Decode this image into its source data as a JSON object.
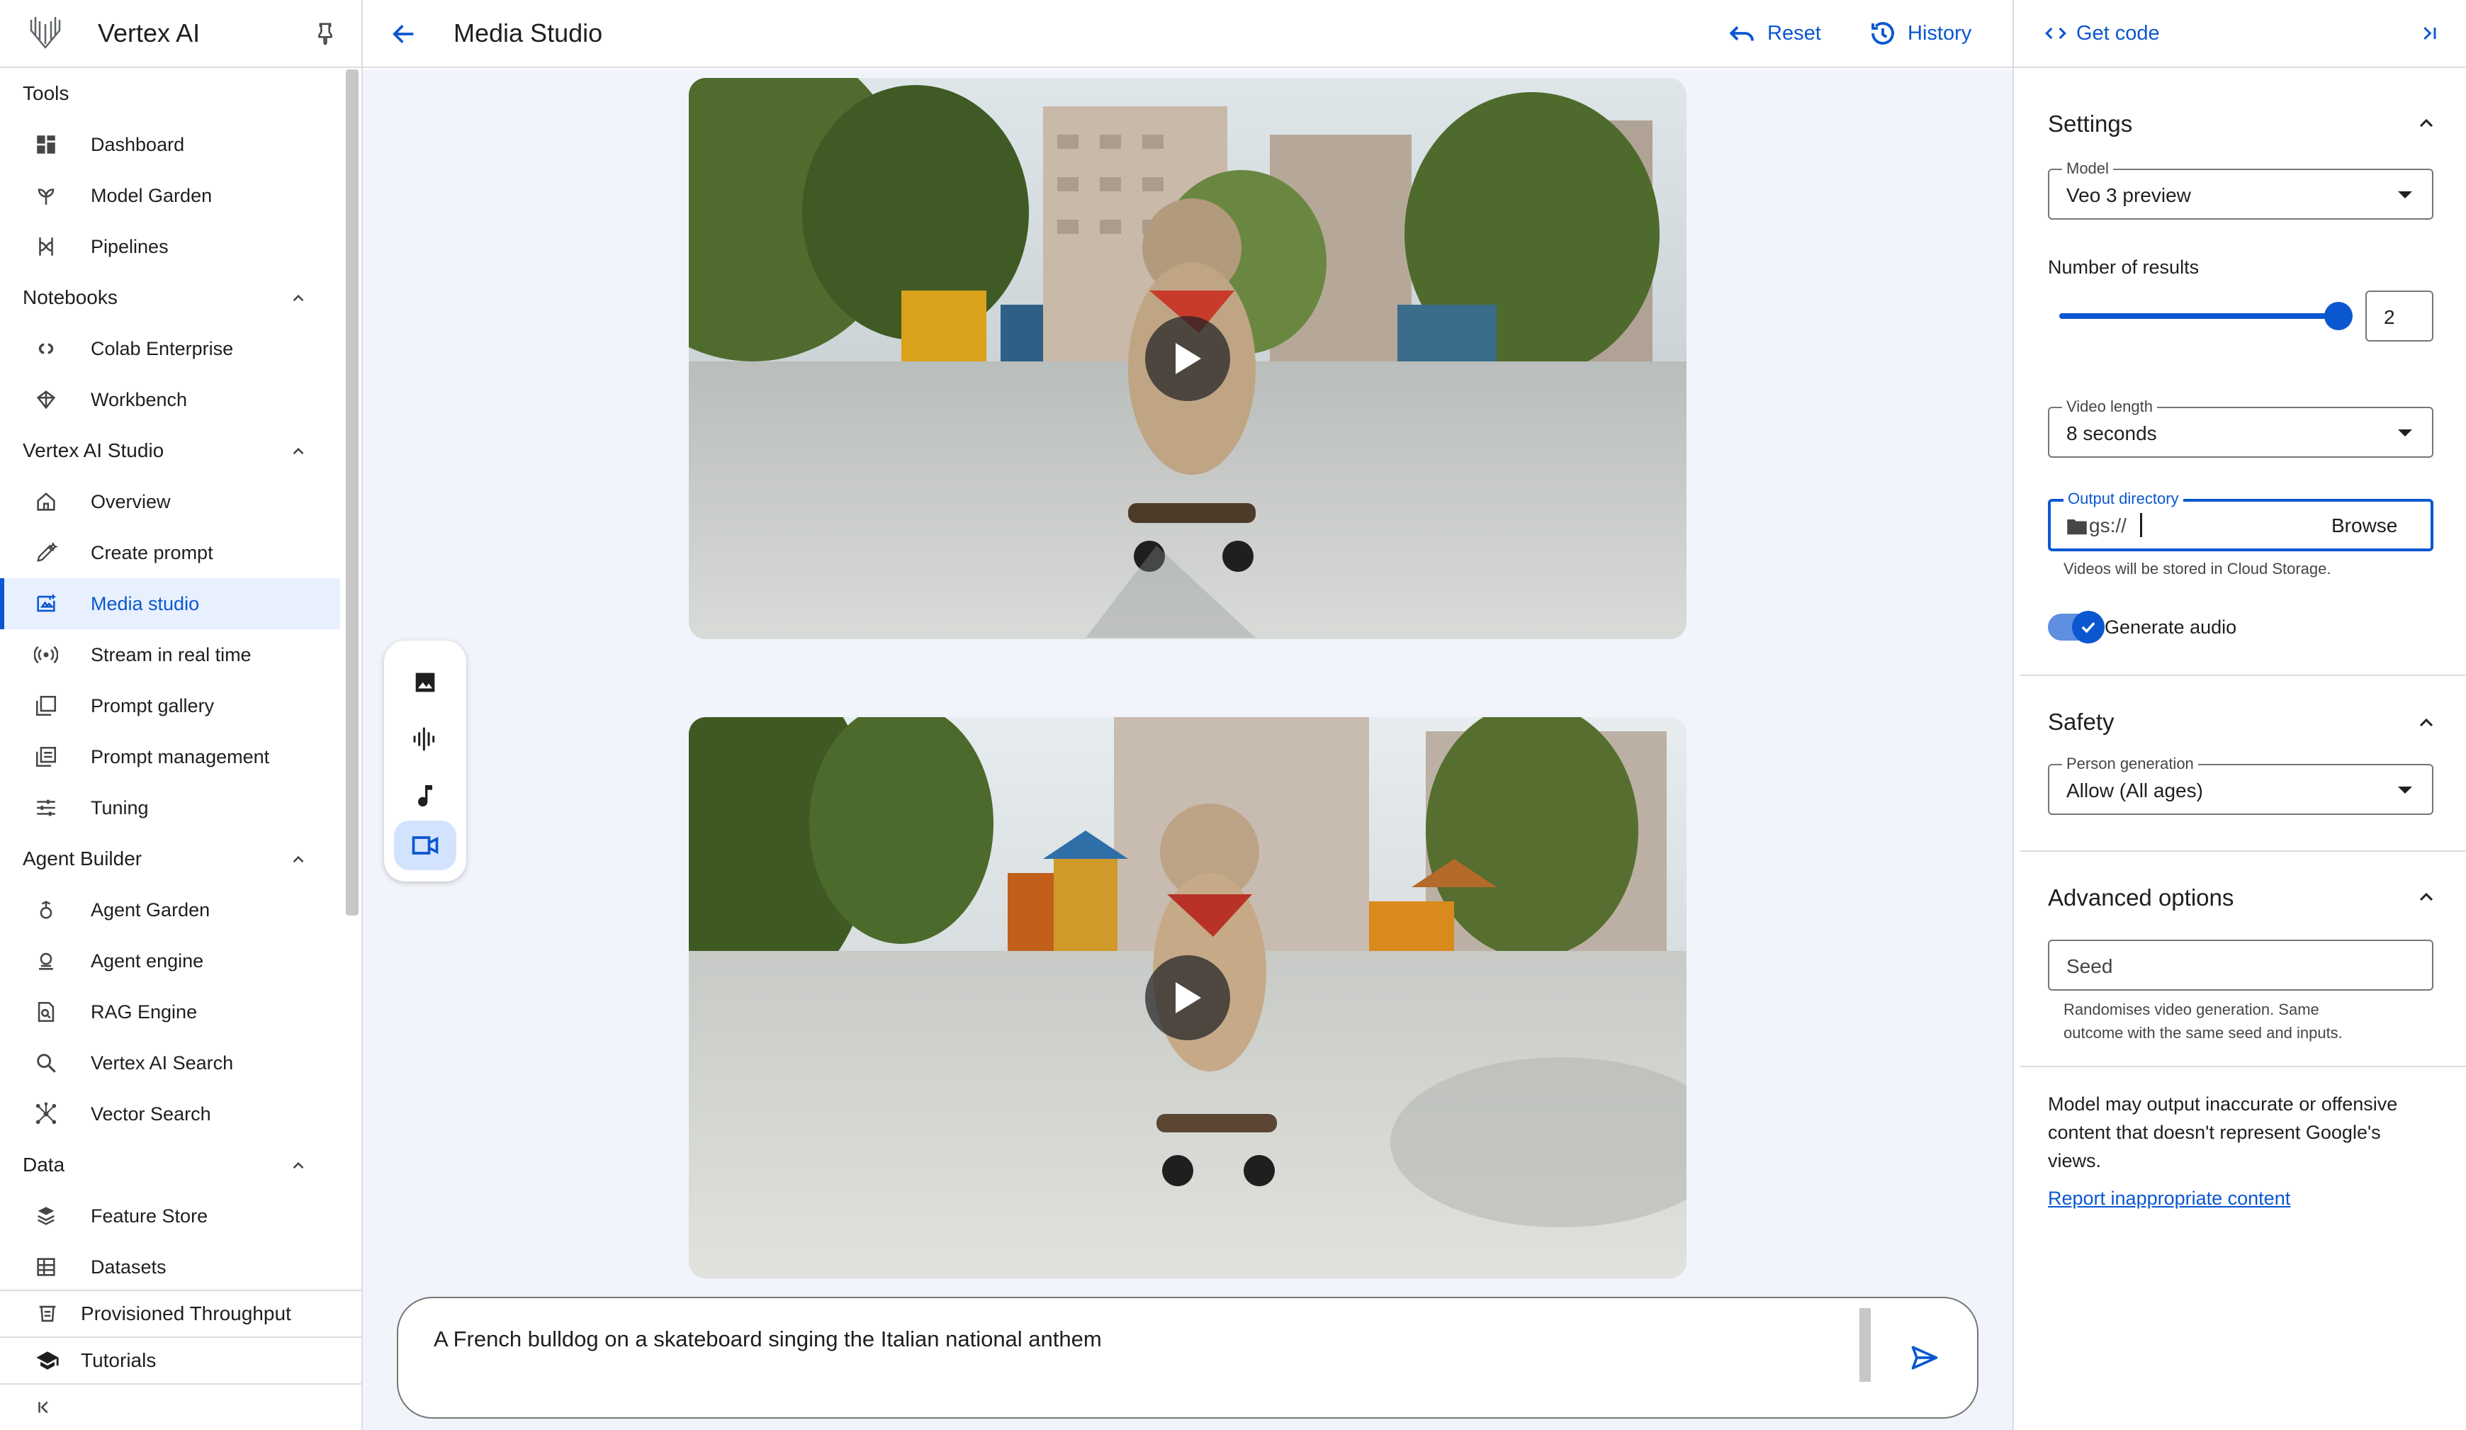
{
  "app": {
    "title": "Vertex AI"
  },
  "sidebar": {
    "sections": [
      {
        "title": "Tools",
        "collapsible": false,
        "items": [
          {
            "label": "Dashboard",
            "icon": "dashboard-icon"
          },
          {
            "label": "Model Garden",
            "icon": "model-garden-icon"
          },
          {
            "label": "Pipelines",
            "icon": "pipelines-icon"
          }
        ]
      },
      {
        "title": "Notebooks",
        "collapsible": true,
        "items": [
          {
            "label": "Colab Enterprise",
            "icon": "colab-icon"
          },
          {
            "label": "Workbench",
            "icon": "workbench-icon"
          }
        ]
      },
      {
        "title": "Vertex AI Studio",
        "collapsible": true,
        "items": [
          {
            "label": "Overview",
            "icon": "home-icon"
          },
          {
            "label": "Create prompt",
            "icon": "create-prompt-icon"
          },
          {
            "label": "Media studio",
            "icon": "media-studio-icon",
            "active": true
          },
          {
            "label": "Stream in real time",
            "icon": "stream-icon"
          },
          {
            "label": "Prompt gallery",
            "icon": "prompt-gallery-icon"
          },
          {
            "label": "Prompt management",
            "icon": "prompt-management-icon"
          },
          {
            "label": "Tuning",
            "icon": "tuning-icon"
          }
        ]
      },
      {
        "title": "Agent Builder",
        "collapsible": true,
        "items": [
          {
            "label": "Agent Garden",
            "icon": "agent-garden-icon"
          },
          {
            "label": "Agent engine",
            "icon": "agent-engine-icon"
          },
          {
            "label": "RAG Engine",
            "icon": "rag-engine-icon"
          },
          {
            "label": "Vertex AI Search",
            "icon": "search-icon"
          },
          {
            "label": "Vector Search",
            "icon": "vector-search-icon"
          }
        ]
      },
      {
        "title": "Data",
        "collapsible": true,
        "items": [
          {
            "label": "Feature Store",
            "icon": "feature-store-icon"
          },
          {
            "label": "Datasets",
            "icon": "datasets-icon"
          }
        ]
      }
    ],
    "footer": {
      "provisioned": "Provisioned Throughput",
      "tutorials": "Tutorials"
    }
  },
  "header": {
    "title": "Media Studio",
    "reset_label": "Reset",
    "history_label": "History"
  },
  "prompt": {
    "text": "A French bulldog on a skateboard singing the Italian national anthem"
  },
  "panel": {
    "get_code_label": "Get code",
    "settings": {
      "title": "Settings",
      "model_label": "Model",
      "model_value": "Veo 3 preview",
      "num_results_label": "Number of results",
      "num_results_value": "2",
      "num_results_max": 2,
      "video_length_label": "Video length",
      "video_length_value": "8 seconds",
      "output_dir_label": "Output directory",
      "output_dir_prefix": "gs://",
      "browse_label": "Browse",
      "output_dir_helper": "Videos will be stored in Cloud Storage.",
      "generate_audio_label": "Generate audio",
      "generate_audio_on": true
    },
    "safety": {
      "title": "Safety",
      "person_gen_label": "Person generation",
      "person_gen_value": "Allow (All ages)"
    },
    "advanced": {
      "title": "Advanced options",
      "seed_placeholder": "Seed",
      "seed_helper_1": "Randomises video generation. Same",
      "seed_helper_2": "outcome with the same seed and inputs."
    },
    "disclaimer": "Model may output inaccurate or offensive content that doesn't represent Google's views.",
    "report_label": "Report inappropriate content"
  },
  "colors": {
    "accent": "#0b57d0",
    "active_bg": "#e8f0fe",
    "canvas_bg": "#f1f4fa"
  }
}
